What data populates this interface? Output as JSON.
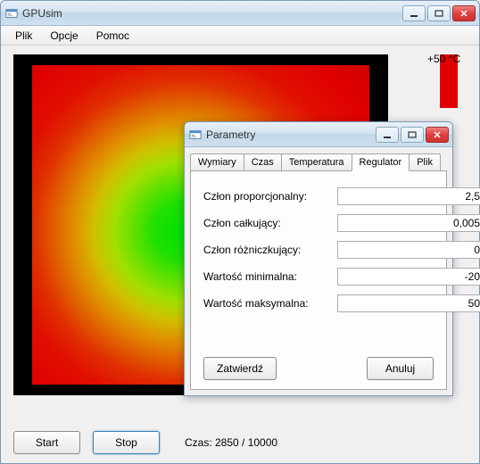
{
  "main": {
    "title": "GPUsim",
    "menu": {
      "file": "Plik",
      "options": "Opcje",
      "help": "Pomoc"
    },
    "tempScaleLabel": "+50 °C",
    "buttons": {
      "start": "Start",
      "stop": "Stop"
    },
    "status": "Czas: 2850 / 10000"
  },
  "dialog": {
    "title": "Parametry",
    "tabs": {
      "dims": "Wymiary",
      "time": "Czas",
      "temp": "Temperatura",
      "reg": "Regulator",
      "file": "Plik"
    },
    "fields": {
      "kp": {
        "label": "Człon proporcjonalny:",
        "value": "2,5"
      },
      "ki": {
        "label": "Człon całkujący:",
        "value": "0,005"
      },
      "kd": {
        "label": "Człon różniczkujący:",
        "value": "0"
      },
      "min": {
        "label": "Wartość minimalna:",
        "value": "-20"
      },
      "max": {
        "label": "Wartość maksymalna:",
        "value": "50"
      }
    },
    "buttons": {
      "ok": "Zatwierdź",
      "cancel": "Anuluj"
    }
  }
}
